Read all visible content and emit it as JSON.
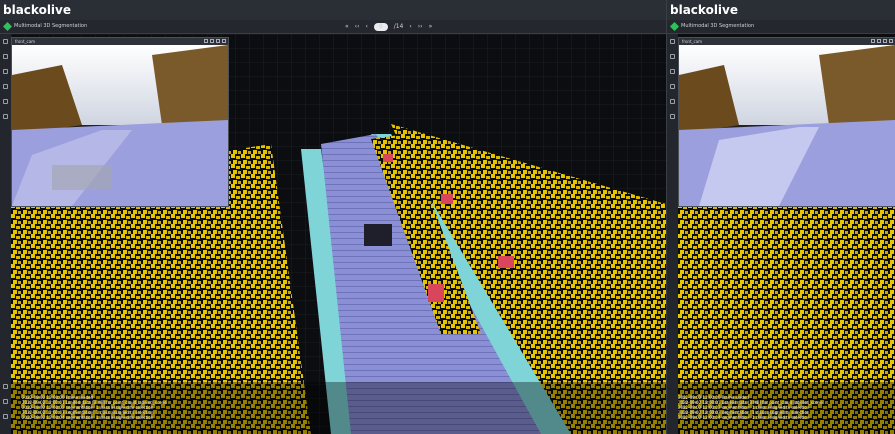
{
  "app": {
    "brand": "blackolive"
  },
  "toolbar": {
    "task_title": "Multimodal 3D Segmentation",
    "nav": {
      "first": "«",
      "prev10": "‹‹",
      "prev": "‹",
      "frame": "8",
      "total": "/14",
      "next": "›",
      "next10": "››",
      "last": "»"
    }
  },
  "camera": {
    "label": "front_cam"
  },
  "log": {
    "lines": [
      "2022-09-02 12:00:00 Frame loaded",
      "2022-09-02 12:00:01 Loaded data (3 MB) for point_cloud_labeled_scene",
      "2022-09-02 12:00:02 segmentation: 1 class assigned to selection",
      "2022-09-02 12:00:03 segmentation: 1 class assigned to selection",
      "2022-09-02 12:00:04 segmentation: 1 class assigned to selection"
    ]
  },
  "colors": {
    "road": "#8a8fd6",
    "vegetation": "#e5c400",
    "car": "#d9455a",
    "sidewalk": "#7fd4d8",
    "background": "#0c0d10"
  }
}
